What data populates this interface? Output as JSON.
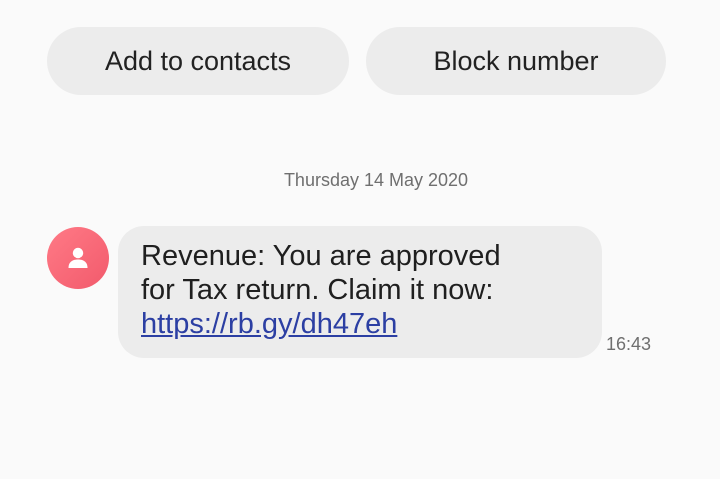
{
  "actions": {
    "add_contacts_label": "Add to contacts",
    "block_number_label": "Block number"
  },
  "conversation": {
    "date": "Thursday 14 May 2020",
    "message": {
      "line1": "Revenue: You are approved",
      "line2": "for Tax return. Claim it now:",
      "link": "https://rb.gy/dh47eh",
      "time": "16:43"
    }
  },
  "colors": {
    "avatar": "#f25a6c",
    "bubble": "#ececec",
    "link": "#2c3fa3"
  },
  "icons": {
    "avatar": "person-icon"
  }
}
